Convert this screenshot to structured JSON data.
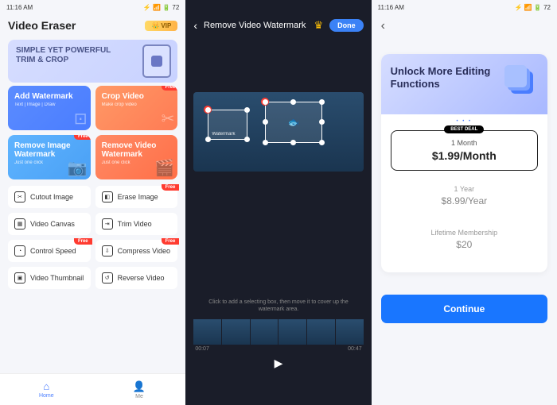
{
  "status": {
    "time": "11:16 AM",
    "icons": "⚡ 📶 🔋 72"
  },
  "screen1": {
    "title": "Video Eraser",
    "vip": "VIP",
    "hero": {
      "line1": "SIMPLE YET POWERFUL",
      "line2": "TRIM & CROP"
    },
    "tiles": [
      {
        "title": "Add Watermark",
        "sub": "Text | Image | Draw",
        "free": false
      },
      {
        "title": "Crop Video",
        "sub": "Make crop video",
        "free": true
      },
      {
        "title": "Remove Image Watermark",
        "sub": "Just one click",
        "free": true
      },
      {
        "title": "Remove Video Watermark",
        "sub": "Just one click",
        "free": false
      }
    ],
    "list": [
      {
        "label": "Cutout Image",
        "free": false
      },
      {
        "label": "Erase Image",
        "free": true
      },
      {
        "label": "Video Canvas",
        "free": false
      },
      {
        "label": "Trim Video",
        "free": false
      },
      {
        "label": "Control Speed",
        "free": true
      },
      {
        "label": "Compress Video",
        "free": true
      },
      {
        "label": "Video Thumbnail",
        "free": false
      },
      {
        "label": "Reverse Video",
        "free": false
      }
    ],
    "free_label": "Free",
    "tabs": {
      "home": "Home",
      "me": "Me"
    }
  },
  "screen2": {
    "title": "Remove Video Watermark",
    "done": "Done",
    "watermark_label": "Watermark",
    "hint": "Click to add a selecting box, then move it to cover up the watermark area.",
    "time_start": "00:07",
    "time_end": "00:47"
  },
  "screen3": {
    "hero": "Unlock More Editing Functions",
    "best_deal": "BEST DEAL",
    "plans": [
      {
        "name": "1 Month",
        "price": "$1.99/Month"
      },
      {
        "name": "1 Year",
        "price": "$8.99/Year"
      },
      {
        "name": "Lifetime Membership",
        "price": "$20"
      }
    ],
    "continue": "Continue"
  }
}
